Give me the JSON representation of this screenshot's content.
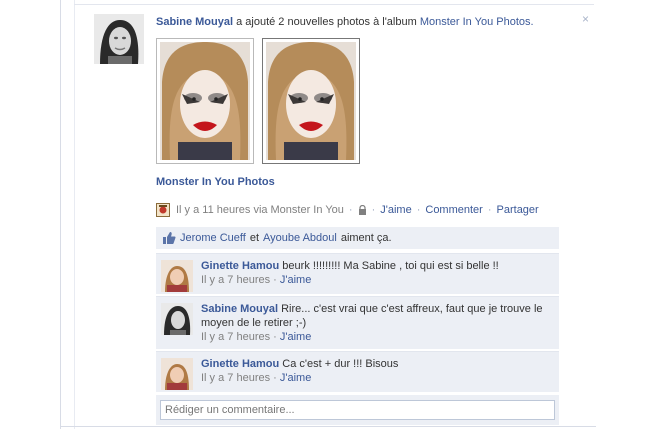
{
  "story": {
    "actor": "Sabine Mouyal",
    "action_before": "a ajouté 2 nouvelles photos à l'album",
    "album_link": "Monster In You Photos.",
    "close_label": "×"
  },
  "album_title": "Monster In You Photos",
  "meta": {
    "time_via": "Il y a 11 heures via",
    "app_name": "Monster In You",
    "like": "J'aime",
    "comment": "Commenter",
    "share": "Partager",
    "sep": "·"
  },
  "likes": {
    "person1": "Jerome Cueff",
    "and": "et",
    "person2": "Ayoube Abdoul",
    "suffix": "aiment ça."
  },
  "comments": [
    {
      "author": "Ginette Hamou",
      "text": "beurk !!!!!!!!! Ma Sabine , toi qui est si belle !!",
      "time": "Il y a 7 heures",
      "like": "J'aime"
    },
    {
      "author": "Sabine Mouyal",
      "text": "Rire... c'est vrai que c'est affreux, faut que je trouve le moyen de le retirer ;-)",
      "time": "Il y a 7 heures",
      "like": "J'aime"
    },
    {
      "author": "Ginette Hamou",
      "text": "Ca c'est + dur !!! Bisous",
      "time": "Il y a 7 heures",
      "like": "J'aime"
    }
  ],
  "reply": {
    "placeholder": "Rédiger un commentaire..."
  },
  "colors": {
    "link": "#3b5998",
    "panel": "#eceff5",
    "muted": "#808080",
    "lipstick": "#c4161c"
  },
  "icons": [
    "close-icon",
    "app-icon",
    "lock-icon",
    "thumbs-up-icon"
  ]
}
